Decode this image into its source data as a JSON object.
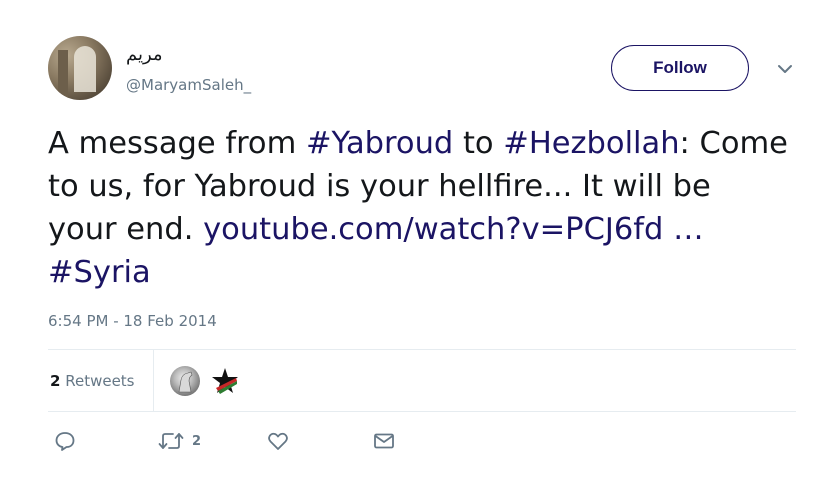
{
  "user": {
    "display_name": "مريم",
    "handle": "@MaryamSaleh_"
  },
  "follow_button": {
    "label": "Follow"
  },
  "tweet": {
    "text_1": "A message from ",
    "hashtag_1": "#Yabroud",
    "text_2": " to ",
    "hashtag_2": "#Hezbollah",
    "text_3": ": Come to us, for Yabroud is your hellfire... It will be your end. ",
    "link": "youtube.com/watch?v=PCJ6fd",
    "ellipsis": " … ",
    "hashtag_3": "#Syria",
    "timestamp": "6:54 PM - 18 Feb 2014"
  },
  "stats": {
    "retweets_count": "2",
    "retweets_label": "Retweets"
  },
  "actions": {
    "retweet_count": "2"
  },
  "colors": {
    "link": "#1b1464",
    "muted": "#657786",
    "divider": "#e6ecf0"
  }
}
